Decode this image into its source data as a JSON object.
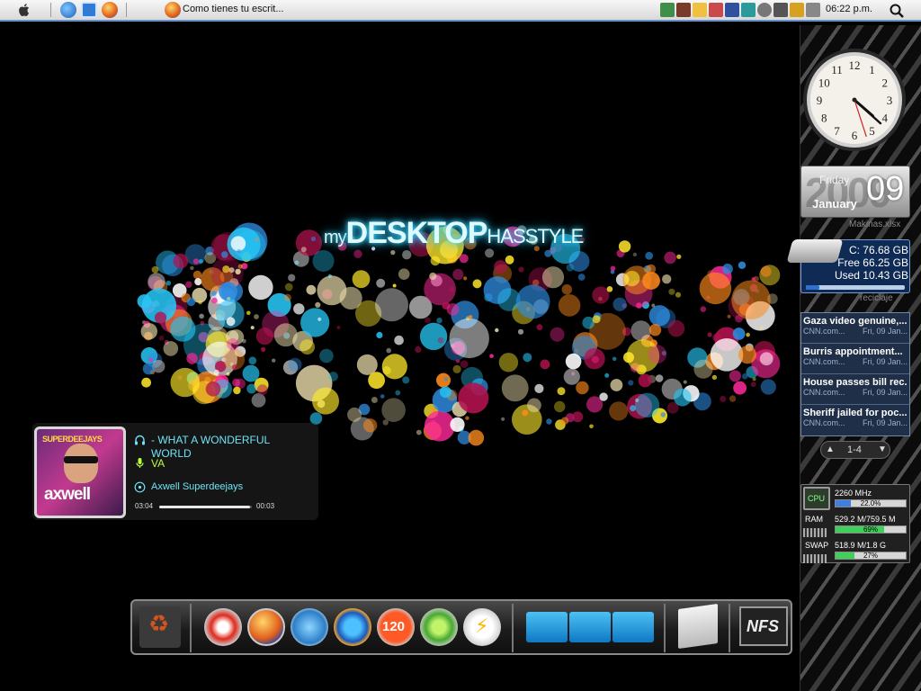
{
  "menubar": {
    "task_title": "Como tienes tu escrit...",
    "clock": "06:22 p.m."
  },
  "wallpaper": {
    "title_part1": "my",
    "title_part2": "DESKTOP",
    "title_part3": "HASSTYLE"
  },
  "music": {
    "title": " - WHAT A WONDERFUL WORLD",
    "artist": "VA",
    "album": "Axwell Superdeejays",
    "elapsed": "03:04",
    "remaining": "00:03",
    "progress_fraction": 0.98,
    "cover_top_text": "SUPERDEEJAYS",
    "cover_name_text": "axwell"
  },
  "dock": {
    "items": [
      "recycle-bin",
      "nero-burning",
      "firefox",
      "messenger",
      "media-player",
      "120",
      "sony-ericsson",
      "flash",
      "folder",
      "folder",
      "folder",
      "display",
      "nfs"
    ],
    "counter_label": "120",
    "nfs_label": "NFS"
  },
  "sidebar": {
    "clock": {
      "hour": 4,
      "minute": 22,
      "second": 27
    },
    "date": {
      "day_name": "Friday",
      "month": "January",
      "day": "09",
      "year_bg": "2009"
    },
    "file_label": "Makinas.xlsx",
    "drive": {
      "line1": "C:  76.68 GB",
      "line2": "Free 66.25 GB",
      "line3": "Used 10.43 GB",
      "used_fraction": 0.136
    },
    "recycle_label": "reciclaje",
    "news": [
      {
        "title": "Gaza video genuine,...",
        "source": "CNN.com...",
        "date": "Fri, 09 Jan..."
      },
      {
        "title": "Burris appointment...",
        "source": "CNN.com...",
        "date": "Fri, 09 Jan..."
      },
      {
        "title": "House passes bill rec...",
        "source": "CNN.com...",
        "date": "Fri, 09 Jan..."
      },
      {
        "title": "Sheriff jailed for poc...",
        "source": "CNN.com...",
        "date": "Fri, 09 Jan..."
      }
    ],
    "news_page": "1-4",
    "system": {
      "cpu_label": "CPU",
      "cpu_speed": "2260 MHz",
      "cpu_percent": "22.0%",
      "cpu_fraction": 0.22,
      "ram_label": "RAM",
      "ram_value": "529.2 M/759.5 M",
      "ram_percent": "69%",
      "ram_fraction": 0.69,
      "swap_label": "SWAP",
      "swap_value": "518.9 M/1.8 G",
      "swap_percent": "27%",
      "swap_fraction": 0.27
    }
  },
  "colors": {
    "song_cyan": "#6fe3f5",
    "artist_green": "#b9ff3a",
    "menubar_accent": "#6a8fc9"
  }
}
